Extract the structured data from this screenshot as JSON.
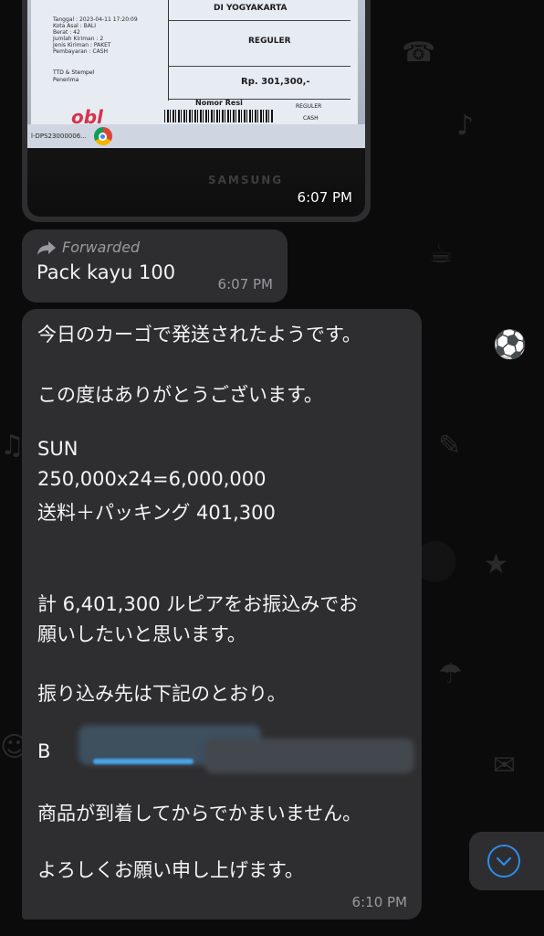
{
  "image_message": {
    "receipt": {
      "destination": "DI YOGYAKARTA",
      "service": "REGULER",
      "price": "Rp. 301,300,-",
      "resi_label": "Nomor Resi",
      "service_small": "REGULER",
      "payment_small": "CASH",
      "details": [
        "Tanggal : 2023-04-11 17:20:09",
        "Kota Asal : BALI",
        "Berat : 42",
        "Jumlah Kiriman : 2",
        "Jenis Kiriman : PAKET",
        "Pembayaran : CASH"
      ],
      "ttd": "TTD & Stempel",
      "penerima": "Penerima",
      "brand": "obl",
      "taskbar_text": "l-DPS23000006...",
      "monitor_brand": "SAMSUNG"
    },
    "time": "6:07 PM"
  },
  "forwarded_message": {
    "label": "Forwarded",
    "text": "Pack kayu 100",
    "time": "6:07 PM"
  },
  "text_message": {
    "lines": [
      "今日のカーゴで発送されたようです。",
      "この度はありがとうございます。",
      "SUN",
      "250,000x24=6,000,000",
      "送料＋パッキング 401,300",
      "計 6,401,300 ルピアをお振込みでお",
      "願いしたいと思います。",
      "振り込み先は下記のとおり。",
      "B",
      "商品が到着してからでかまいません。",
      "よろしくお願い申し上げます。"
    ],
    "time": "6:10 PM"
  },
  "colors": {
    "bubble": "#2e2e30",
    "background": "#0b0b0b",
    "accent": "#2f8ce8"
  },
  "icons": {
    "forward": "forward-arrow-icon",
    "scroll_down": "chevron-down-icon",
    "browser": "chrome-icon"
  }
}
